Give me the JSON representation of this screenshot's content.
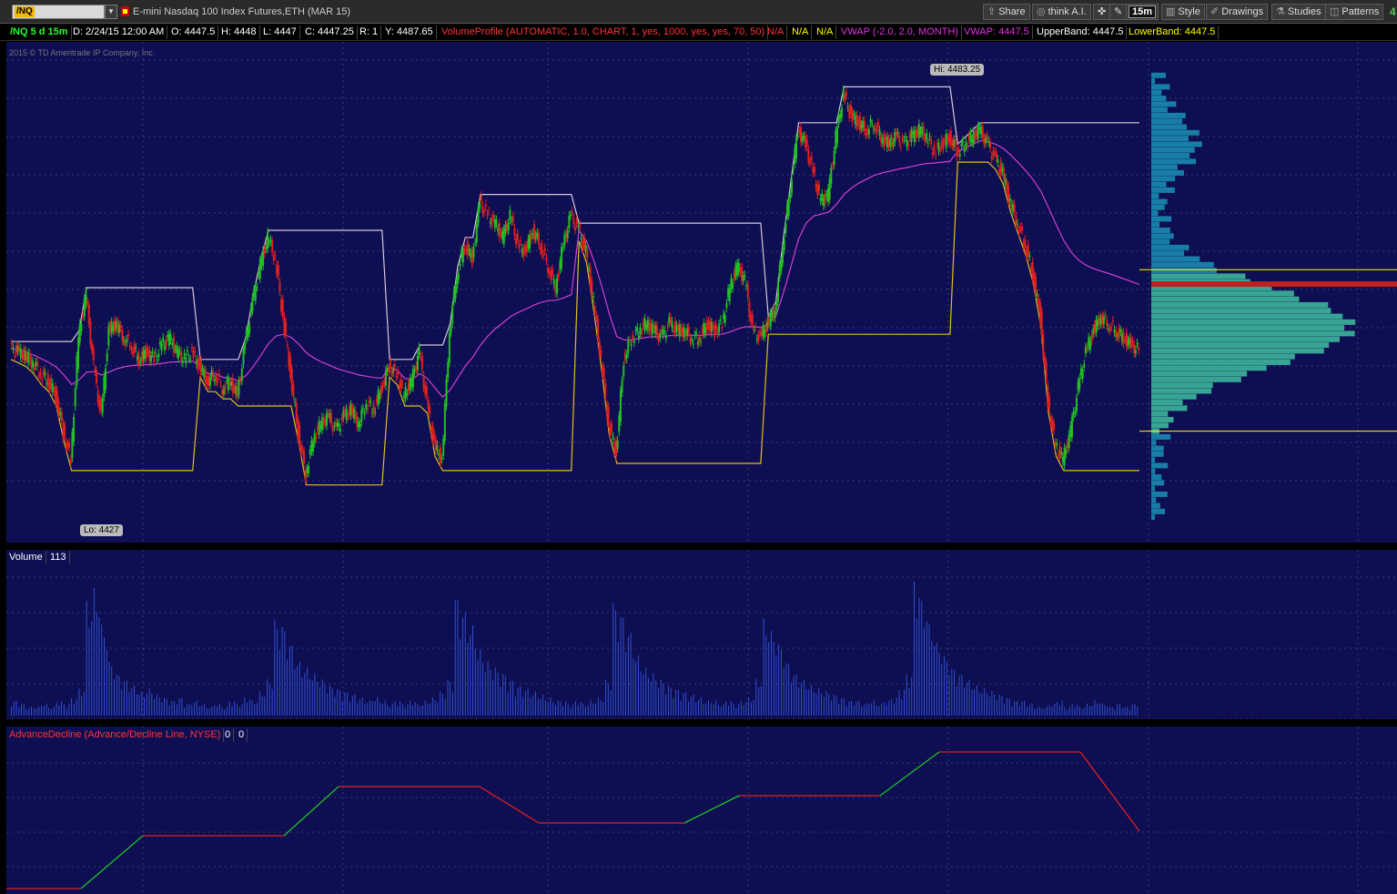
{
  "toolbar": {
    "symbol": "/NQ",
    "description": "E-mini Nasdaq 100 Index Futures,ETH (MAR 15)",
    "share": "Share",
    "think_ai": "think A.I.",
    "timeframe": "15m",
    "style": "Style",
    "drawings": "Drawings",
    "studies": "Studies",
    "patterns": "Patterns",
    "corner_digit": "4"
  },
  "info": {
    "chart_label": "/NQ 5 d 15m",
    "date": "D: 2/24/15 12:00 AM",
    "open": "O: 4447.5",
    "high": "H: 4448",
    "low": "L: 4447",
    "close": "C: 4447.25",
    "range": "R: 1",
    "y": "Y: 4487.65",
    "volume_profile": "VolumeProfile (AUTOMATIC, 1.0, CHART, 1, yes, 1000, yes, yes, 70, 50)",
    "na1": "N/A",
    "na2": "N/A",
    "na3": "N/A",
    "vwap_study": "VWAP (-2.0, 2.0, MONTH)",
    "vwap_value": "VWAP: 4447.5",
    "upper_band": "UpperBand: 4447.5",
    "lower_band": "LowerBand: 4447.5"
  },
  "copyright": "2015 © TD Ameritrade IP Company, Inc.",
  "hi_label": "Hi: 4483.25",
  "lo_label": "Lo: 4427",
  "volume_pane": {
    "label": "Volume",
    "value": "113"
  },
  "ad_pane": {
    "label": "AdvanceDecline (Advance/Decline Line, NYSE)",
    "value1": "0",
    "value2": "0"
  },
  "colors": {
    "background": "#0e0e52",
    "grid": "#3a3a6a",
    "up_candle": "#22c022",
    "down_candle": "#e02020",
    "vwap": "#d040d0",
    "upper_band": "#d8c8d8",
    "lower_band": "#e0c020",
    "volume_bars": "#3050d0",
    "profile": "#1a8ab0",
    "value_area": "#40c0a0"
  },
  "chart_data": [
    {
      "type": "line",
      "title": "/NQ 5 d 15m",
      "series_note_none": "",
      "ylim": [
        4423,
        4489
      ],
      "x": [
        0,
        5,
        10,
        15,
        20,
        25,
        30,
        35,
        40,
        45,
        50,
        55,
        60,
        65,
        70,
        75,
        80,
        85,
        90,
        95,
        100,
        105,
        110,
        115,
        120,
        125,
        130,
        135,
        140,
        145,
        150,
        155,
        160,
        165,
        170,
        175,
        180,
        185,
        190,
        195,
        200,
        205,
        210,
        215,
        220,
        225,
        230,
        235,
        240,
        245,
        250,
        255,
        260,
        265,
        270,
        275,
        280,
        285,
        290,
        295,
        300,
        305,
        310,
        315,
        320,
        325,
        330,
        335,
        340,
        345,
        350,
        355,
        360,
        365,
        370,
        375,
        380,
        385,
        390,
        395,
        400,
        405,
        410,
        415,
        420,
        425,
        430,
        435,
        440,
        445,
        450,
        455,
        460,
        465,
        470,
        475,
        480,
        485,
        490,
        495,
        500,
        505,
        510,
        515,
        520,
        525,
        530,
        535,
        540,
        545,
        550,
        555,
        560,
        565,
        570,
        575,
        580,
        585,
        590,
        595,
        600,
        605,
        610,
        615,
        620,
        625,
        630,
        635,
        640,
        645,
        650,
        655,
        660,
        665,
        670,
        675,
        680,
        685,
        690,
        695,
        700,
        705,
        710,
        715,
        720,
        725,
        730,
        735,
        740,
        745
      ],
      "series": [
        {
          "values": [
            4447.5,
            4447,
            4446.5,
            4445.5,
            4444,
            4443,
            4441,
            4436,
            4432,
            4449,
            4455,
            4445,
            4438,
            4450,
            4451,
            4449,
            4448,
            4446,
            4447,
            4446,
            4448,
            4449,
            4447,
            4446,
            4447,
            4445,
            4443,
            4444,
            4442,
            4443,
            4441,
            4448,
            4454,
            4459,
            4463,
            4460,
            4452,
            4444,
            4436,
            4430,
            4435,
            4437,
            4438,
            4436,
            4438,
            4439,
            4437,
            4440,
            4439,
            4442,
            4445,
            4444,
            4441,
            4443,
            4447,
            4440,
            4434,
            4432,
            4450,
            4458,
            4462,
            4460,
            4468,
            4466,
            4465,
            4463,
            4466,
            4462,
            4461,
            4464,
            4462,
            4459,
            4456,
            4462,
            4466,
            4464,
            4461,
            4454,
            4446,
            4437,
            4433,
            4446,
            4449,
            4450,
            4451,
            4450,
            4449,
            4451,
            4450,
            4450,
            4449,
            4449,
            4451,
            4450,
            4451,
            4456,
            4459,
            4457,
            4450,
            4449,
            4451,
            4453,
            4462,
            4470,
            4478,
            4476,
            4472,
            4468,
            4469,
            4477,
            4483,
            4480,
            4479,
            4478,
            4479,
            4477,
            4476,
            4477,
            4476,
            4477,
            4478,
            4477,
            4475,
            4476,
            4477,
            4475,
            4476,
            4477,
            4478,
            4476,
            4474,
            4472,
            4468,
            4465,
            4462,
            4458,
            4452,
            4440,
            4434,
            4432,
            4436,
            4442,
            4447,
            4450,
            4452,
            4451,
            4450,
            4449,
            4448,
            4447.25
          ]
        }
      ]
    },
    {
      "type": "bar",
      "title": "Volume",
      "series_values_note": "",
      "values": [
        5,
        4,
        3,
        3,
        4,
        3,
        5,
        4,
        6,
        9,
        38,
        42,
        30,
        18,
        14,
        12,
        10,
        8,
        9,
        7,
        6,
        5,
        6,
        4,
        5,
        4,
        3,
        4,
        3,
        5,
        4,
        6,
        5,
        8,
        12,
        32,
        30,
        24,
        18,
        16,
        14,
        12,
        10,
        9,
        8,
        7,
        6,
        5,
        6,
        5,
        4,
        5,
        4,
        5,
        4,
        5,
        6,
        8,
        12,
        40,
        35,
        30,
        22,
        18,
        16,
        14,
        12,
        10,
        9,
        8,
        7,
        6,
        5,
        5,
        4,
        5,
        4,
        5,
        6,
        12,
        38,
        34,
        28,
        20,
        16,
        14,
        12,
        10,
        9,
        8,
        7,
        6,
        5,
        5,
        4,
        5,
        4,
        5,
        6,
        12,
        32,
        28,
        24,
        18,
        14,
        12,
        10,
        9,
        8,
        7,
        6,
        5,
        5,
        4,
        5,
        4,
        5,
        6,
        9,
        14,
        45,
        38,
        30,
        24,
        20,
        16,
        14,
        12,
        10,
        9,
        8,
        7,
        6,
        5,
        5,
        4,
        3,
        3,
        4,
        5,
        3,
        4,
        3,
        4,
        5,
        4,
        3,
        4,
        3,
        4
      ]
    },
    {
      "type": "line",
      "title": "AdvanceDecline (Advance/Decline Line, NYSE)",
      "values": [
        0,
        0,
        0,
        0,
        0,
        0,
        0,
        0,
        0,
        0,
        0,
        0,
        0,
        0,
        0,
        0,
        0,
        0,
        0,
        0,
        0,
        0,
        0,
        0,
        0,
        0,
        0,
        0,
        0,
        0,
        0,
        0,
        0,
        0,
        0,
        0,
        0,
        0,
        0,
        0,
        0,
        0,
        0,
        0,
        0,
        0,
        0,
        0,
        0,
        0,
        0,
        0,
        0,
        0,
        0,
        0,
        0,
        0,
        0,
        0,
        0,
        0,
        0,
        0,
        0,
        0,
        0,
        0,
        0,
        0,
        0,
        0,
        0,
        0,
        0,
        0,
        0,
        0,
        0,
        0,
        0,
        0,
        0,
        0,
        0,
        0,
        0,
        0,
        0,
        0,
        0,
        0,
        0,
        0,
        0,
        0,
        0,
        0,
        0,
        0,
        0,
        0,
        0,
        0,
        0,
        0,
        0,
        0,
        0,
        0,
        0,
        0,
        0,
        0,
        0,
        0,
        0,
        0,
        0,
        0,
        0,
        0,
        0,
        0,
        0,
        0,
        0,
        0,
        0,
        0,
        0,
        0,
        0,
        0,
        0,
        0,
        0,
        0,
        0,
        0,
        0,
        0,
        0,
        0,
        0,
        0,
        0,
        0,
        0,
        0
      ]
    }
  ]
}
